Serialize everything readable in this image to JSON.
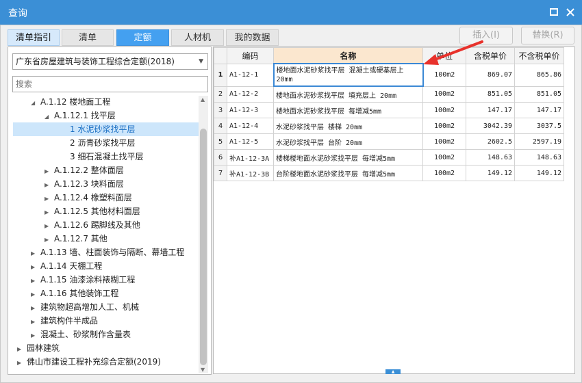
{
  "window": {
    "title": "查询"
  },
  "tabs": [
    "清单指引",
    "清单",
    "定额",
    "人材机",
    "我的数据"
  ],
  "toolbar": {
    "insert": "插入(I)",
    "replace": "替换(R)"
  },
  "library": {
    "selected": "广东省房屋建筑与装饰工程综合定额(2018)"
  },
  "search": {
    "placeholder": "搜索"
  },
  "tree": [
    "A.1.12 楼地面工程",
    "A.1.12.1 找平层",
    "1 水泥砂浆找平层",
    "2 沥青砂浆找平层",
    "3 细石混凝土找平层",
    "A.1.12.2 整体面层",
    "A.1.12.3 块料面层",
    "A.1.12.4 橡塑料面层",
    "A.1.12.5 其他材料面层",
    "A.1.12.6 踢脚线及其他",
    "A.1.12.7 其他",
    "A.1.13 墙、柱面装饰与隔断、幕墙工程",
    "A.1.14 天棚工程",
    "A.1.15 油漆涂料裱糊工程",
    "A.1.16 其他装饰工程",
    "建筑物超高增加人工、机械",
    "建筑构件半成品",
    "混凝土、砂浆制作含量表",
    "园林建筑",
    "佛山市建设工程补充综合定额(2019)"
  ],
  "table": {
    "headers": [
      "编码",
      "名称",
      "单位",
      "含税单价",
      "不含税单价"
    ],
    "rows": [
      {
        "no": "1",
        "code": "A1-12-1",
        "name": "楼地面水泥砂浆找平层 混凝土或硬基层上 20mm",
        "unit": "100m2",
        "tax": "869.07",
        "notax": "865.86"
      },
      {
        "no": "2",
        "code": "A1-12-2",
        "name": "楼地面水泥砂浆找平层 填充层上 20mm",
        "unit": "100m2",
        "tax": "851.05",
        "notax": "851.05"
      },
      {
        "no": "3",
        "code": "A1-12-3",
        "name": "楼地面水泥砂浆找平层 每增减5mm",
        "unit": "100m2",
        "tax": "147.17",
        "notax": "147.17"
      },
      {
        "no": "4",
        "code": "A1-12-4",
        "name": "水泥砂浆找平层 楼梯 20mm",
        "unit": "100m2",
        "tax": "3042.39",
        "notax": "3037.5"
      },
      {
        "no": "5",
        "code": "A1-12-5",
        "name": "水泥砂浆找平层 台阶 20mm",
        "unit": "100m2",
        "tax": "2602.5",
        "notax": "2597.19"
      },
      {
        "no": "6",
        "code": "补A1-12-3A",
        "name": "楼梯楼地面水泥砂浆找平层 每增减5mm",
        "unit": "100m2",
        "tax": "148.63",
        "notax": "148.63"
      },
      {
        "no": "7",
        "code": "补A1-12-3B",
        "name": "台阶楼地面水泥砂浆找平层 每增减5mm",
        "unit": "100m2",
        "tax": "149.12",
        "notax": "149.12"
      }
    ]
  },
  "colors": {
    "titlebar": "#3b8fd6",
    "active_tab": "#44a0f0",
    "selection": "#cde6fb",
    "annotation_arrow": "#e8322c"
  }
}
